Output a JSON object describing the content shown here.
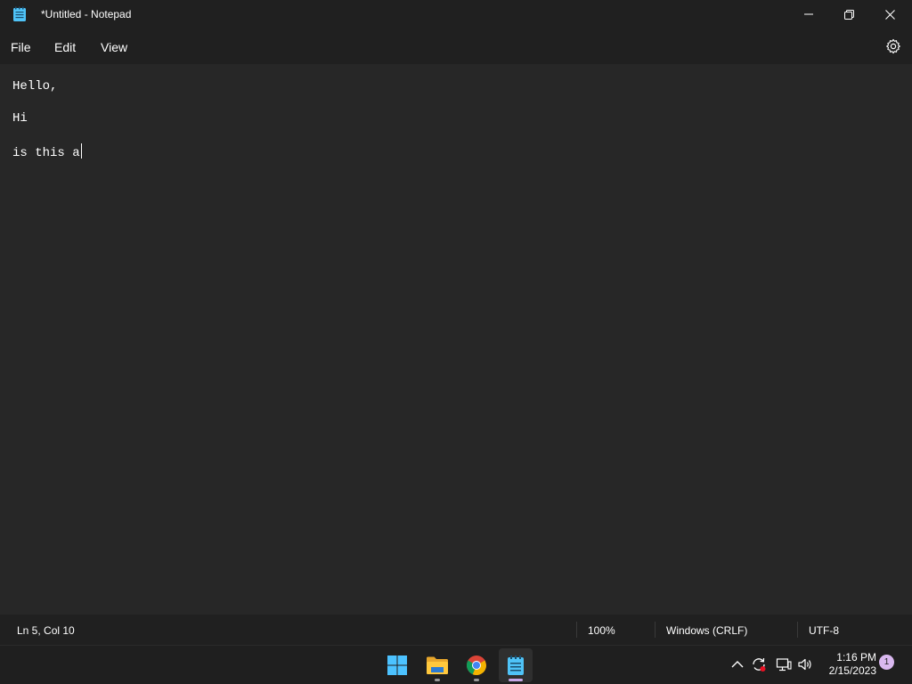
{
  "window": {
    "title": "*Untitled - Notepad"
  },
  "menu": {
    "file": "File",
    "edit": "Edit",
    "view": "View"
  },
  "editor": {
    "lines": [
      "Hello,",
      "Hi",
      "is this a"
    ]
  },
  "status": {
    "position": "Ln 5, Col 10",
    "zoom": "100%",
    "line_ending": "Windows (CRLF)",
    "encoding": "UTF-8"
  },
  "taskbar": {
    "apps": [
      "start-icon",
      "file-explorer-icon",
      "chrome-icon",
      "notepad-icon"
    ],
    "active_app": "notepad-icon"
  },
  "tray": {
    "time": "1:16 PM",
    "date": "2/15/2023",
    "notification_count": "1"
  },
  "colors": {
    "background": "#202020",
    "editor_bg": "#272727",
    "accent": "#c8a8e8"
  }
}
